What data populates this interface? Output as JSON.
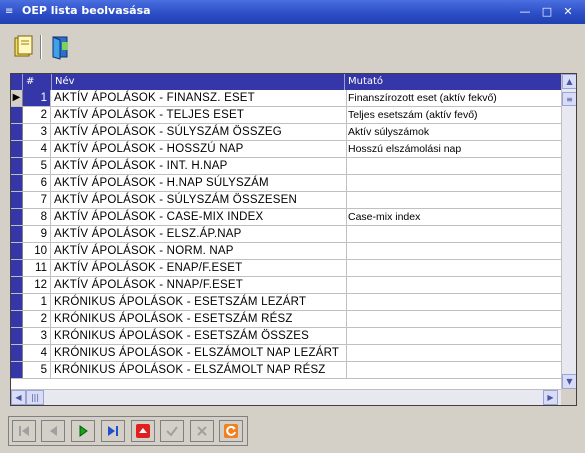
{
  "window": {
    "title": "OEP lista beolvasása"
  },
  "grid": {
    "columns": [
      "#",
      "Név",
      "Mutató"
    ],
    "rows": [
      {
        "num": "1",
        "nev": "AKTÍV ÁPOLÁSOK - FINANSZ. ESET",
        "mutato": "Finanszírozott eset (aktív fekvő)"
      },
      {
        "num": "2",
        "nev": "AKTÍV ÁPOLÁSOK - TELJES ESET",
        "mutato": "Teljes esetszám (aktív fevő)"
      },
      {
        "num": "3",
        "nev": "AKTÍV ÁPOLÁSOK - SÚLYSZÁM ÖSSZEG",
        "mutato": "Aktív súlyszámok"
      },
      {
        "num": "4",
        "nev": "AKTÍV ÁPOLÁSOK - HOSSZÚ NAP",
        "mutato": "Hosszú elszámolási nap"
      },
      {
        "num": "5",
        "nev": "AKTÍV ÁPOLÁSOK - INT. H.NAP",
        "mutato": ""
      },
      {
        "num": "6",
        "nev": "AKTÍV ÁPOLÁSOK - H.NAP SÚLYSZÁM",
        "mutato": ""
      },
      {
        "num": "7",
        "nev": "AKTÍV ÁPOLÁSOK - SÚLYSZÁM ÖSSZESEN",
        "mutato": ""
      },
      {
        "num": "8",
        "nev": "AKTÍV ÁPOLÁSOK - CASE-MIX INDEX",
        "mutato": "Case-mix index"
      },
      {
        "num": "9",
        "nev": "AKTÍV ÁPOLÁSOK - ELSZ.ÁP.NAP",
        "mutato": ""
      },
      {
        "num": "10",
        "nev": "AKTÍV ÁPOLÁSOK - NORM. NAP",
        "mutato": ""
      },
      {
        "num": "11",
        "nev": "AKTÍV ÁPOLÁSOK - ENAP/F.ESET",
        "mutato": ""
      },
      {
        "num": "12",
        "nev": "AKTÍV ÁPOLÁSOK - NNAP/F.ESET",
        "mutato": ""
      },
      {
        "num": "1",
        "nev": "KRÓNIKUS ÁPOLÁSOK - ESETSZÁM LEZÁRT",
        "mutato": ""
      },
      {
        "num": "2",
        "nev": "KRÓNIKUS ÁPOLÁSOK - ESETSZÁM RÉSZ",
        "mutato": ""
      },
      {
        "num": "3",
        "nev": "KRÓNIKUS ÁPOLÁSOK - ESETSZÁM ÖSSZES",
        "mutato": ""
      },
      {
        "num": "4",
        "nev": "KRÓNIKUS ÁPOLÁSOK - ELSZÁMOLT  NAP LEZÁRT",
        "mutato": ""
      },
      {
        "num": "5",
        "nev": "KRÓNIKUS ÁPOLÁSOK - ELSZÁMOLT  NAP RÉSZ",
        "mutato": ""
      }
    ]
  },
  "colors": {
    "accent": "#3537a8",
    "titlebar": "#2a4cc4"
  }
}
